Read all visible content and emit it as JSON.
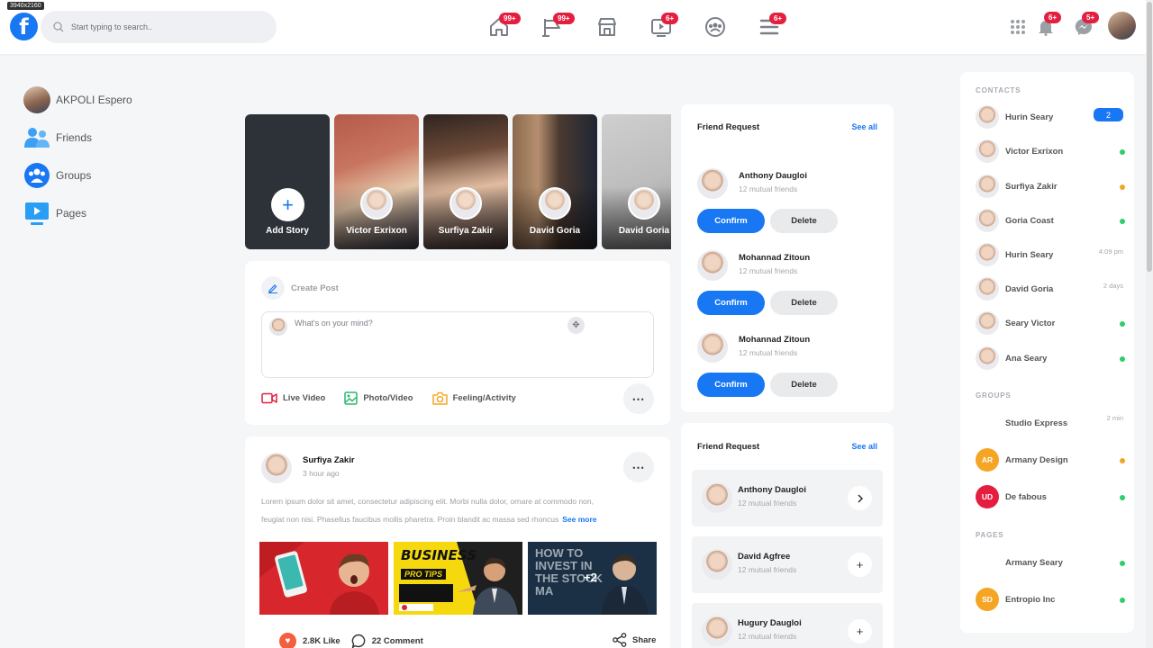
{
  "screen_size_badge": "3940x2160",
  "header": {
    "search_placeholder": "Start typing to search..",
    "nav": [
      {
        "name": "home",
        "badge": "99+"
      },
      {
        "name": "flag",
        "badge": "99+"
      },
      {
        "name": "store",
        "badge": ""
      },
      {
        "name": "video",
        "badge": "6+"
      },
      {
        "name": "groups",
        "badge": ""
      },
      {
        "name": "menu",
        "badge": "6+"
      }
    ],
    "notifications_badge": "6+",
    "messenger_badge": "5+"
  },
  "left_nav": {
    "user_name": "AKPOLI Espero",
    "items": [
      {
        "label": "Friends",
        "icon": "friends-icon"
      },
      {
        "label": "Groups",
        "icon": "groups-icon"
      },
      {
        "label": "Pages",
        "icon": "pages-icon"
      }
    ]
  },
  "stories": {
    "add_label": "Add Story",
    "items": [
      {
        "name": "Victor Exrixon"
      },
      {
        "name": "Surfiya Zakir"
      },
      {
        "name": "David Goria"
      },
      {
        "name": "David Goria"
      }
    ]
  },
  "create_post": {
    "title": "Create Post",
    "placeholder": "What's on your mind?",
    "actions": [
      {
        "label": "Live Video",
        "color": "#e41e3f"
      },
      {
        "label": "Photo/Video",
        "color": "#2bb673"
      },
      {
        "label": "Feeling/Activity",
        "color": "#f5a524"
      }
    ]
  },
  "post": {
    "author": "Surfiya Zakir",
    "time": "3 hour ago",
    "text_line1": "Lorem ipsum dolor sit amet, consectetur adipiscing elit. Morbi nulla dolor, ornare at commodo non,",
    "text_line2": "feugiat non nisi. Phasellus faucibus mollis pharetra. Proin blandit ac massa sed rhoncus",
    "see_more": "See more",
    "images": [
      {
        "kind": "red"
      },
      {
        "kind": "yellow",
        "title": "BUSINESS",
        "subtitle": "PRO TIPS"
      },
      {
        "kind": "dark",
        "title": "HOW TO INVEST IN THE STOCK MA",
        "more": "+2"
      }
    ],
    "likes": "2.8K Like",
    "comments": "22 Comment",
    "share": "Share"
  },
  "friend_requests": {
    "title": "Friend Request",
    "see_all": "See all",
    "confirm_label": "Confirm",
    "delete_label": "Delete",
    "items": [
      {
        "name": "Anthony Daugloi",
        "mutual": "12 mutual friends"
      },
      {
        "name": "Mohannad Zitoun",
        "mutual": "12 mutual friends"
      },
      {
        "name": "Mohannad Zitoun",
        "mutual": "12 mutual friends"
      }
    ]
  },
  "friend_requests_2": {
    "title": "Friend Request",
    "see_all": "See all",
    "items": [
      {
        "name": "Anthony Daugloi",
        "mutual": "12 mutual friends",
        "action": "chevron"
      },
      {
        "name": "David Agfree",
        "mutual": "12 mutual friends",
        "action": "plus"
      },
      {
        "name": "Hugury Daugloi",
        "mutual": "12 mutual friends",
        "action": "plus"
      }
    ]
  },
  "contacts": {
    "title": "CONTACTS",
    "items": [
      {
        "name": "Hurin Seary",
        "pill": "2"
      },
      {
        "name": "Victor Exrixon",
        "status": "#2bcf6b"
      },
      {
        "name": "Surfiya Zakir",
        "status": "#f5a524"
      },
      {
        "name": "Goria Coast",
        "status": "#2bcf6b"
      },
      {
        "name": "Hurin Seary",
        "time": "4:09 pm"
      },
      {
        "name": "David Goria",
        "time": "2 days"
      },
      {
        "name": "Seary Victor",
        "status": "#2bcf6b"
      },
      {
        "name": "Ana Seary",
        "status": "#2bcf6b"
      }
    ]
  },
  "groups": {
    "title": "GROUPS",
    "items": [
      {
        "name": "Studio Express",
        "time": "2 min"
      },
      {
        "name": "Armany Design",
        "initials": "AR",
        "color": "#f5a524",
        "status": "#f5a524"
      },
      {
        "name": "De fabous",
        "initials": "UD",
        "color": "#e41e3f",
        "status": "#2bcf6b"
      }
    ]
  },
  "pages": {
    "title": "PAGES",
    "items": [
      {
        "name": "Armany Seary",
        "status": "#2bcf6b"
      },
      {
        "name": "Entropio Inc",
        "initials": "SD",
        "color": "#f5a524",
        "status": "#2bcf6b"
      }
    ]
  }
}
